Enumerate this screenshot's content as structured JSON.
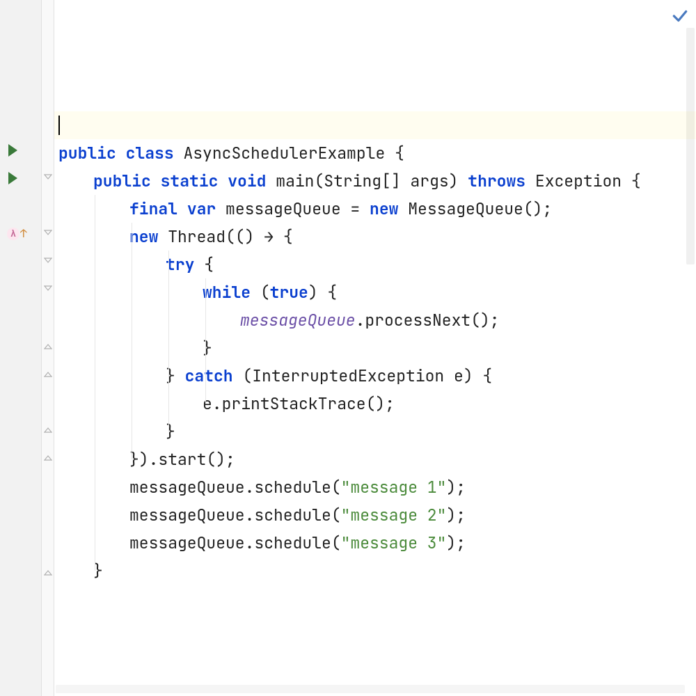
{
  "code": {
    "l5": {
      "kw_public": "public",
      "kw_class": "class",
      "class_name": "AsyncSchedulerExample",
      "brace": " {"
    },
    "l6": {
      "kw_public": "public",
      "kw_static": "static",
      "kw_void": "void",
      "method": "main",
      "params_open": "(String[] args) ",
      "kw_throws": "throws",
      "exc": " Exception {"
    },
    "l7": {
      "kw_final": "final",
      "kw_var": "var",
      "decl": " messageQueue = ",
      "kw_new": "new",
      "ctor": " MessageQueue();"
    },
    "l8": {
      "kw_new": "new",
      "thread_open": " Thread(() ",
      "arrow": "→",
      "brace": " {"
    },
    "l9": {
      "kw_try": "try",
      "brace": " {"
    },
    "l10": {
      "kw_while": "while",
      "open": " (",
      "kw_true": "true",
      "close": ") {"
    },
    "l11": {
      "ref": "messageQueue",
      "call": ".processNext();"
    },
    "l12": {
      "brace": "}"
    },
    "l13": {
      "close_try": "} ",
      "kw_catch": "catch",
      "params": " (InterruptedException e) {"
    },
    "l14": {
      "stmt": "e.printStackTrace();"
    },
    "l15": {
      "brace": "}"
    },
    "l16": {
      "close": "}).start();"
    },
    "l17": {
      "pre": "messageQueue.schedule(",
      "str": "\"message 1\"",
      "post": ");"
    },
    "l18": {
      "pre": "messageQueue.schedule(",
      "str": "\"message 2\"",
      "post": ");"
    },
    "l19": {
      "pre": "messageQueue.schedule(",
      "str": "\"message 3\"",
      "post": ");"
    },
    "l20": {
      "brace": "}"
    }
  },
  "icons": {
    "lambda": "λ"
  }
}
